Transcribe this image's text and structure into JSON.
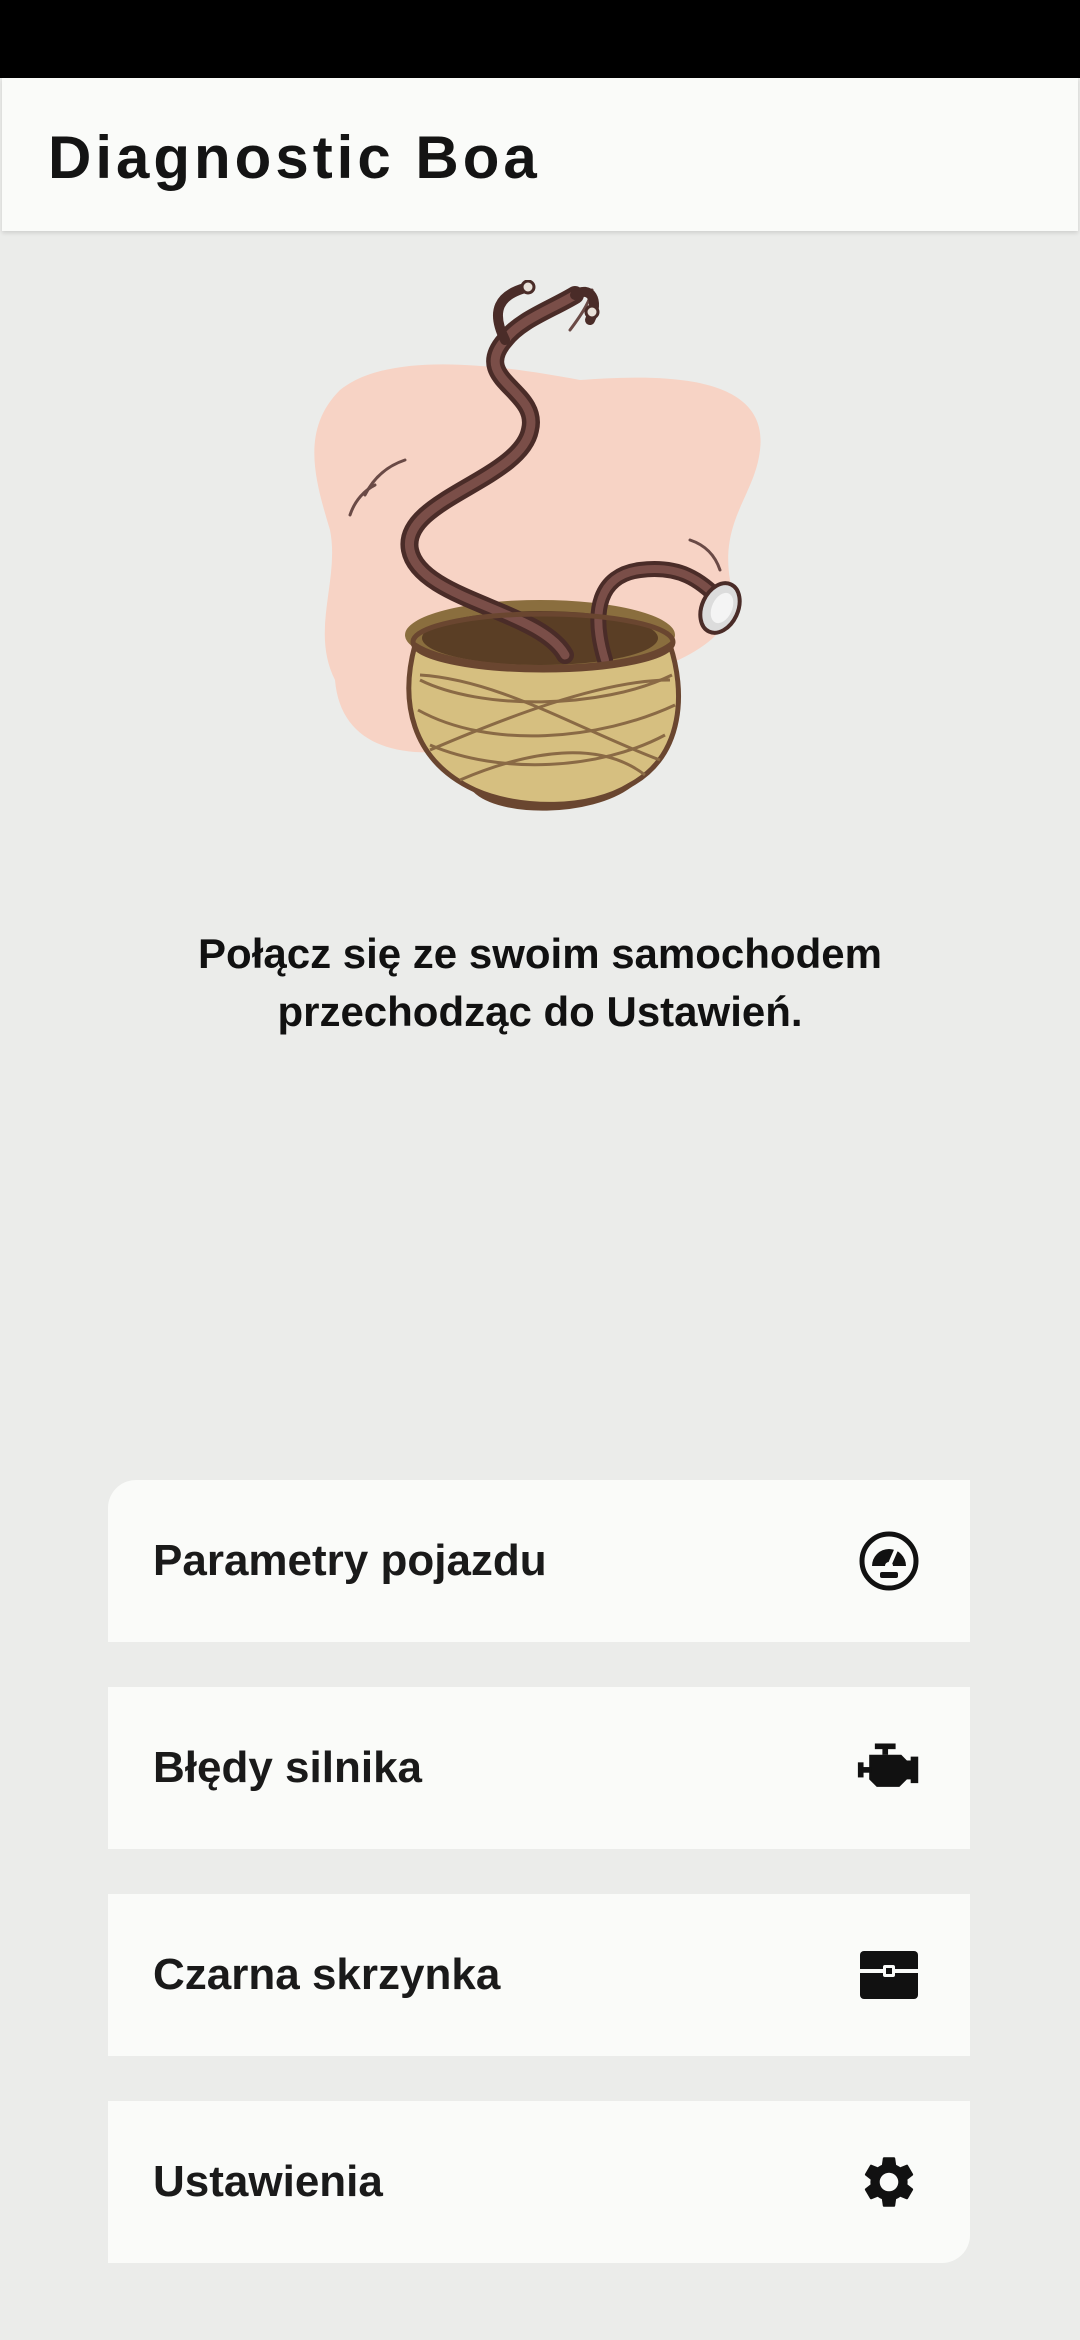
{
  "app": {
    "title": "Diagnostic Boa"
  },
  "main": {
    "message": "Połącz się ze swoim samochodem przechodząc do Ustawień.",
    "illustration": "basket-stethoscope-illustration"
  },
  "menu": {
    "items": [
      {
        "label": "Parametry pojazdu",
        "icon": "gauge-icon"
      },
      {
        "label": "Błędy silnika",
        "icon": "engine-icon"
      },
      {
        "label": "Czarna skrzynka",
        "icon": "toolbox-icon"
      },
      {
        "label": "Ustawienia",
        "icon": "gear-icon"
      }
    ]
  },
  "colors": {
    "background": "#ebecea",
    "surface": "#fafbf9",
    "text": "#1a1a1a",
    "illustration_blob": "#f7d3c5",
    "basket": "#d6bf80",
    "tube": "#5e3a35"
  }
}
